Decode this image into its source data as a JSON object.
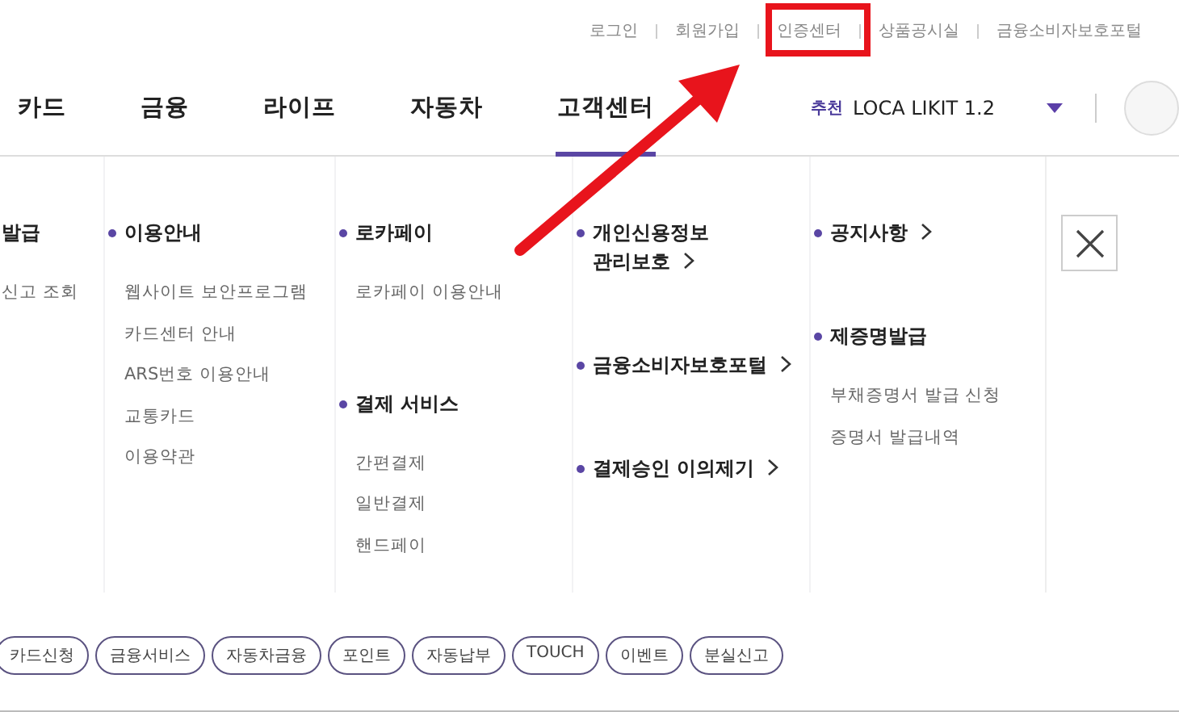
{
  "utility_links": [
    "로그인",
    "회원가입",
    "인증센터",
    "상품공시실",
    "금융소비자보호포털"
  ],
  "nav_tabs": [
    {
      "label": "카드",
      "selected": false
    },
    {
      "label": "금융",
      "selected": false
    },
    {
      "label": "라이프",
      "selected": false
    },
    {
      "label": "자동차",
      "selected": false
    },
    {
      "label": "고객센터",
      "selected": true
    }
  ],
  "recommend": {
    "label": "추천",
    "value": "LOCA LIKIT 1.2"
  },
  "menu": {
    "columns": [
      {
        "sections": [
          {
            "title": "발급",
            "link": false,
            "items": [
              "신고 조회"
            ]
          }
        ]
      },
      {
        "sections": [
          {
            "title": "이용안내",
            "link": false,
            "items": [
              "웹사이트 보안프로그램",
              "카드센터 안내",
              "ARS번호 이용안내",
              "교통카드",
              "이용약관"
            ]
          }
        ]
      },
      {
        "sections": [
          {
            "title": "로카페이",
            "link": false,
            "items": [
              "로카페이 이용안내"
            ]
          },
          {
            "title": "결제 서비스",
            "link": false,
            "items": [
              "간편결제",
              "일반결제",
              "핸드페이"
            ]
          }
        ]
      },
      {
        "sections": [
          {
            "title": "개인신용정보 관리보호",
            "link": true
          },
          {
            "title": "금융소비자보호포털",
            "link": true
          },
          {
            "title": "결제승인 이의제기",
            "link": true
          }
        ]
      },
      {
        "sections": [
          {
            "title": "공지사항",
            "link": true
          },
          {
            "title": "제증명발급",
            "link": false,
            "items": [
              "부채증명서 발급 신청",
              "증명서 발급내역"
            ]
          }
        ]
      }
    ]
  },
  "tags": [
    "카드신청",
    "금융서비스",
    "자동차금융",
    "포인트",
    "자동납부",
    "TOUCH",
    "이벤트",
    "분실신고"
  ],
  "callouts": [
    {
      "kind": "box"
    },
    {
      "kind": "arrow"
    }
  ]
}
